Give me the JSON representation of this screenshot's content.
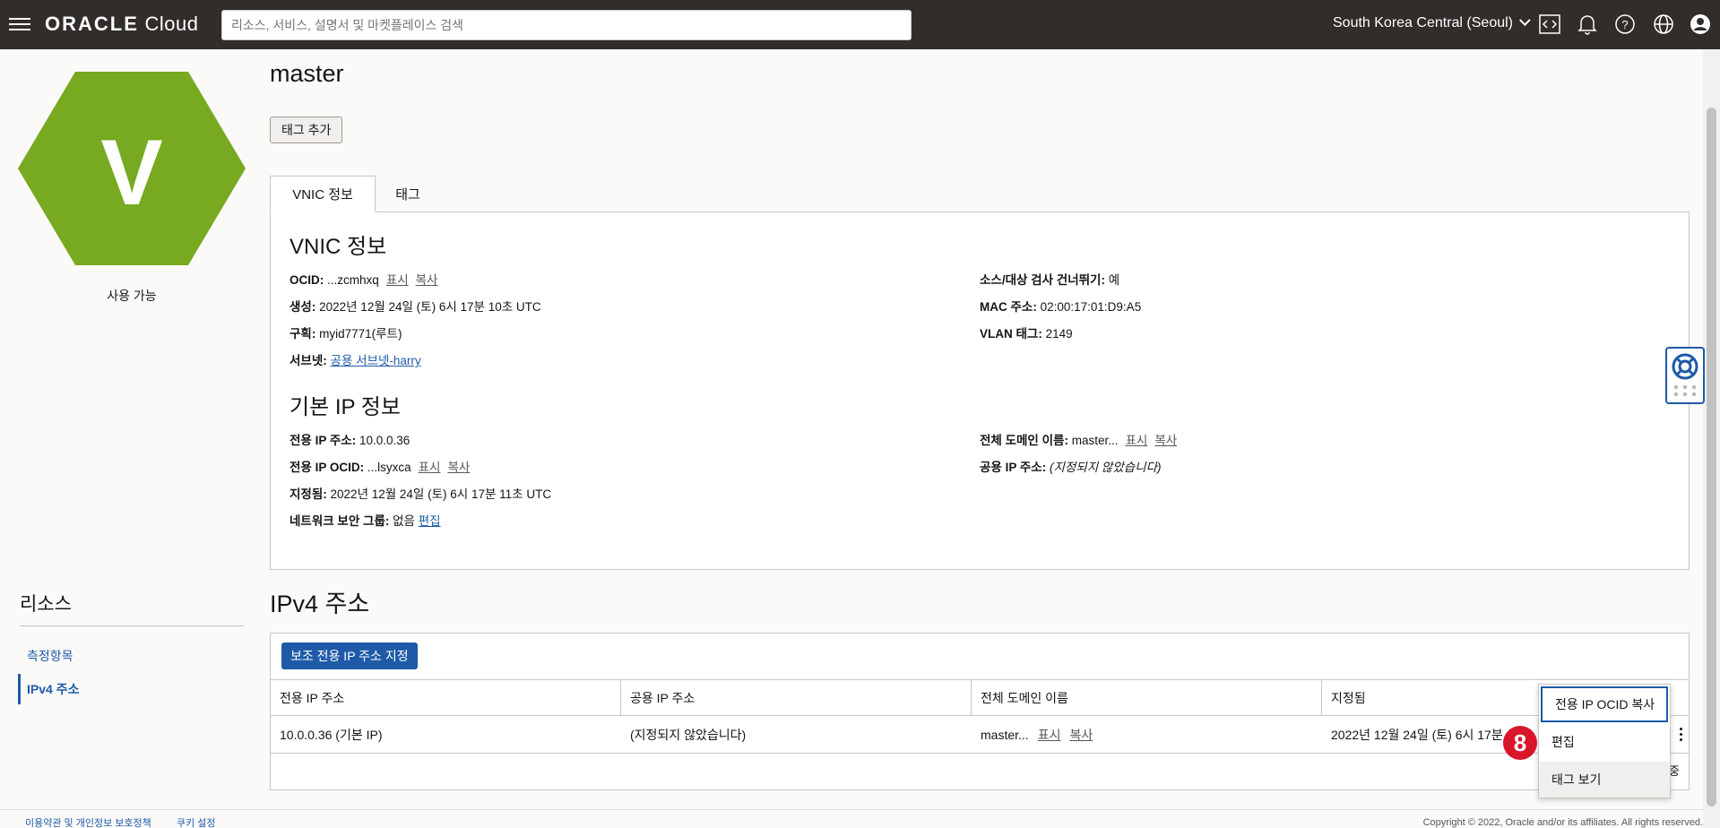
{
  "header": {
    "brand_bold": "ORACLE",
    "brand_light": "Cloud",
    "search_placeholder": "리소스, 서비스, 설명서 및 마켓플레이스 검색",
    "region": "South Korea Central (Seoul)",
    "icons": [
      "menu-icon",
      "code-editor-icon",
      "bell-icon",
      "help-icon",
      "globe-icon",
      "user-icon"
    ]
  },
  "resource": {
    "hex_letter": "V",
    "hex_color": "#77aa21",
    "status": "사용 가능"
  },
  "sidebar": {
    "title": "리소스",
    "items": [
      {
        "label": "측정항목"
      },
      {
        "label": "IPv4 주소"
      }
    ]
  },
  "page": {
    "title": "master",
    "add_tag_button": "태그 추가",
    "tabs": [
      {
        "label": "VNIC 정보"
      },
      {
        "label": "태그"
      }
    ]
  },
  "vnic": {
    "title": "VNIC 정보",
    "ocid_label": "OCID:",
    "ocid_value": "...zcmhxq",
    "show": "표시",
    "copy": "복사",
    "created_label": "생성:",
    "created_value": "2022년 12월 24일 (토) 6시 17분 10초 UTC",
    "compartment_label": "구획:",
    "compartment_value": "myid7771(루트)",
    "subnet_label": "서브넷:",
    "subnet_value": "공용 서브넷-harry",
    "skip_check_label": "소스/대상 검사 건너뛰기:",
    "skip_check_value": "예",
    "mac_label": "MAC 주소:",
    "mac_value": "02:00:17:01:D9:A5",
    "vlan_label": "VLAN 태그:",
    "vlan_value": "2149"
  },
  "primary_ip": {
    "title": "기본 IP 정보",
    "private_ip_label": "전용 IP 주소:",
    "private_ip_value": "10.0.0.36",
    "private_ocid_label": "전용 IP OCID:",
    "private_ocid_value": "...lsyxca",
    "assigned_label": "지정됨:",
    "assigned_value": "2022년 12월 24일 (토) 6시 17분 11초 UTC",
    "nsg_label": "네트워크 보안 그룹:",
    "nsg_value": "없음",
    "nsg_edit": "편집",
    "fqdn_label": "전체 도메인 이름:",
    "fqdn_value": "master...",
    "public_ip_label": "공용 IP 주소:",
    "public_ip_value": "(지정되지 않았습니다)"
  },
  "ipv4": {
    "title": "IPv4 주소",
    "assign_button": "보조 전용 IP 주소 지정",
    "columns": [
      "전용 IP 주소",
      "공용 IP 주소",
      "전체 도메인 이름",
      "지정됨"
    ],
    "row": {
      "private_ip": "10.0.0.36 (기본 IP)",
      "public_ip": "(지정되지 않았습니다)",
      "fqdn": "master...",
      "show": "표시",
      "copy": "복사",
      "assigned": "2022년 12월 24일 (토) 6시 17분"
    },
    "partial_text": "중"
  },
  "context_menu": {
    "items": [
      {
        "label": "전용 IP OCID 복사"
      },
      {
        "label": "편집"
      },
      {
        "label": "태그 보기"
      }
    ],
    "badge": "8"
  },
  "footer": {
    "terms": "이용약관 및 개인정보 보호정책",
    "cookies": "쿠키 설정",
    "copyright": "Copyright © 2022, Oracle and/or its affiliates. All rights reserved."
  }
}
